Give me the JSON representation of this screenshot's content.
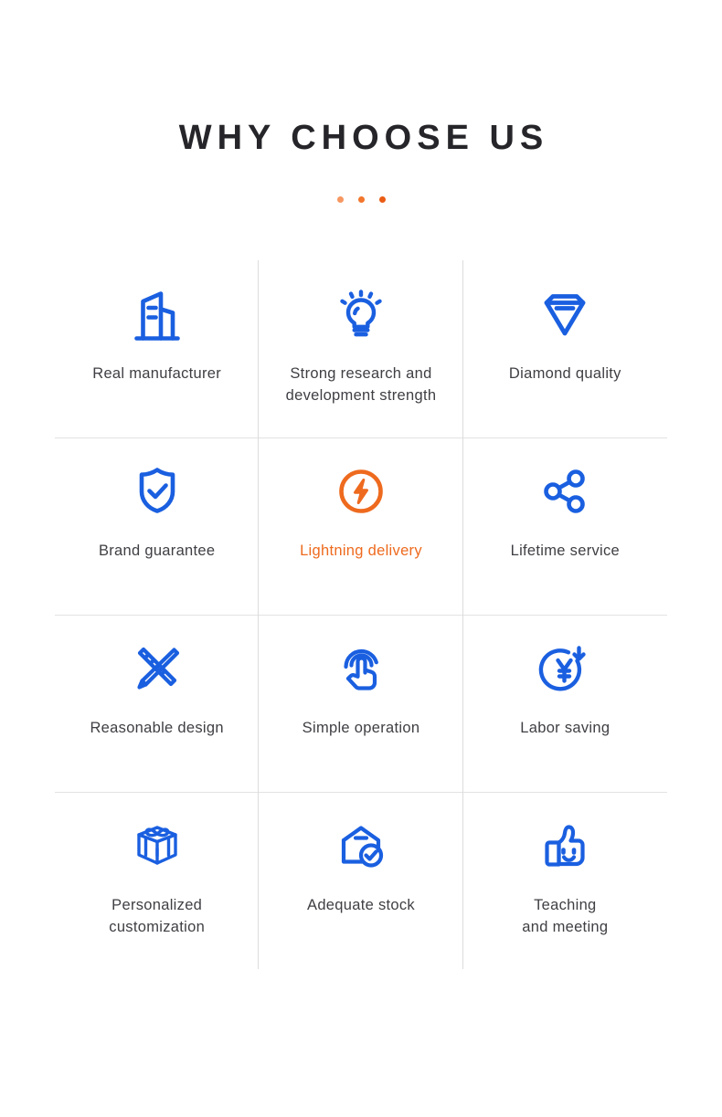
{
  "header": {
    "title": "WHY CHOOSE US",
    "dots": [
      "dot-light",
      "dot-medium",
      "dot-dark"
    ]
  },
  "colors": {
    "icon_blue": "#1a5fe0",
    "accent_orange": "#ee6a1e",
    "title_text": "#26262a",
    "label_text": "#3f3f44",
    "divider": "#dcdcdc",
    "background": "#ffffff"
  },
  "features": [
    {
      "id": "real-manufacturer",
      "label": "Real manufacturer",
      "icon": "factory-building-icon",
      "highlight": false
    },
    {
      "id": "strong-research",
      "label": "Strong research and\ndevelopment strength",
      "icon": "lightbulb-icon",
      "highlight": false
    },
    {
      "id": "diamond-quality",
      "label": "Diamond quality",
      "icon": "diamond-icon",
      "highlight": false
    },
    {
      "id": "brand-guarantee",
      "label": "Brand guarantee",
      "icon": "shield-check-icon",
      "highlight": false
    },
    {
      "id": "lightning-delivery",
      "label": "Lightning delivery",
      "icon": "lightning-bolt-icon",
      "highlight": true
    },
    {
      "id": "lifetime-service",
      "label": "Lifetime service",
      "icon": "share-network-icon",
      "highlight": false
    },
    {
      "id": "reasonable-design",
      "label": "Reasonable design",
      "icon": "pencil-ruler-icon",
      "highlight": false
    },
    {
      "id": "simple-operation",
      "label": "Simple operation",
      "icon": "tap-hand-icon",
      "highlight": false
    },
    {
      "id": "labor-saving",
      "label": "Labor saving",
      "icon": "yen-cost-down-icon",
      "highlight": false
    },
    {
      "id": "personalized-customization",
      "label": "Personalized\ncustomization",
      "icon": "gift-box-icon",
      "highlight": false
    },
    {
      "id": "adequate-stock",
      "label": "Adequate stock",
      "icon": "warehouse-check-icon",
      "highlight": false
    },
    {
      "id": "teaching-and-meeting",
      "label": "Teaching\nand meeting",
      "icon": "thumbs-up-smile-icon",
      "highlight": false
    }
  ]
}
